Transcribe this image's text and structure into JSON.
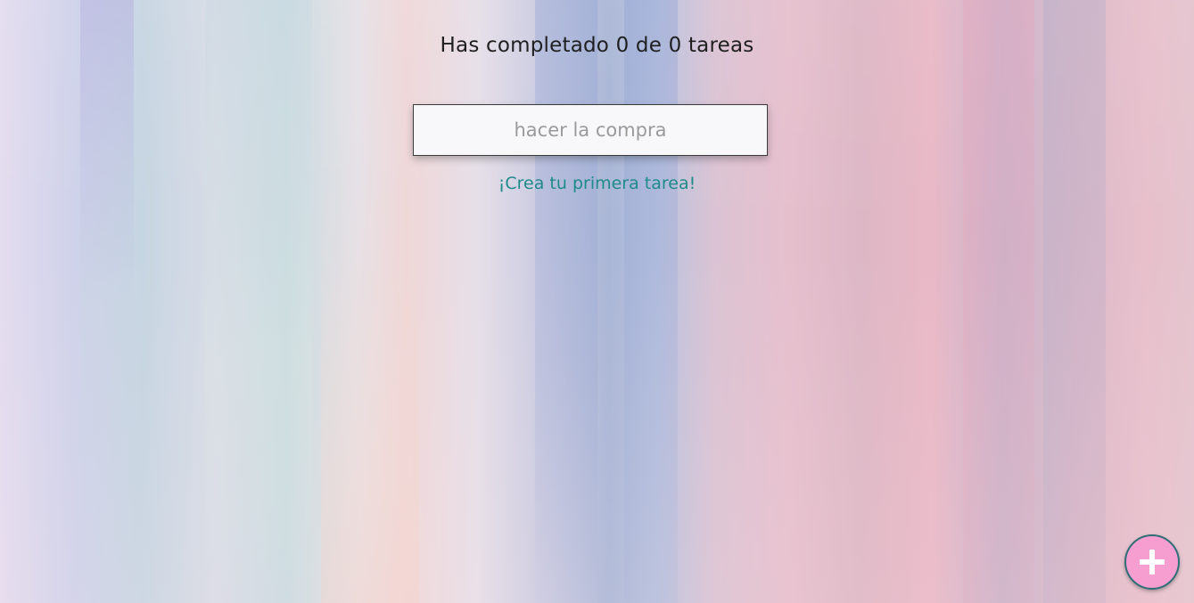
{
  "header": {
    "progress_text": "Has completado 0 de 0 tareas",
    "completed": 0,
    "total": 0
  },
  "task_input": {
    "placeholder": "hacer la compra",
    "value": ""
  },
  "empty_state": {
    "message": "¡Crea tu primera tarea!"
  },
  "add_button": {
    "icon": "plus-icon",
    "color": "#f59ecf",
    "border_color": "#2f6f78"
  },
  "colors": {
    "text": "#1f1f1f",
    "accent": "#1f8a8a"
  }
}
